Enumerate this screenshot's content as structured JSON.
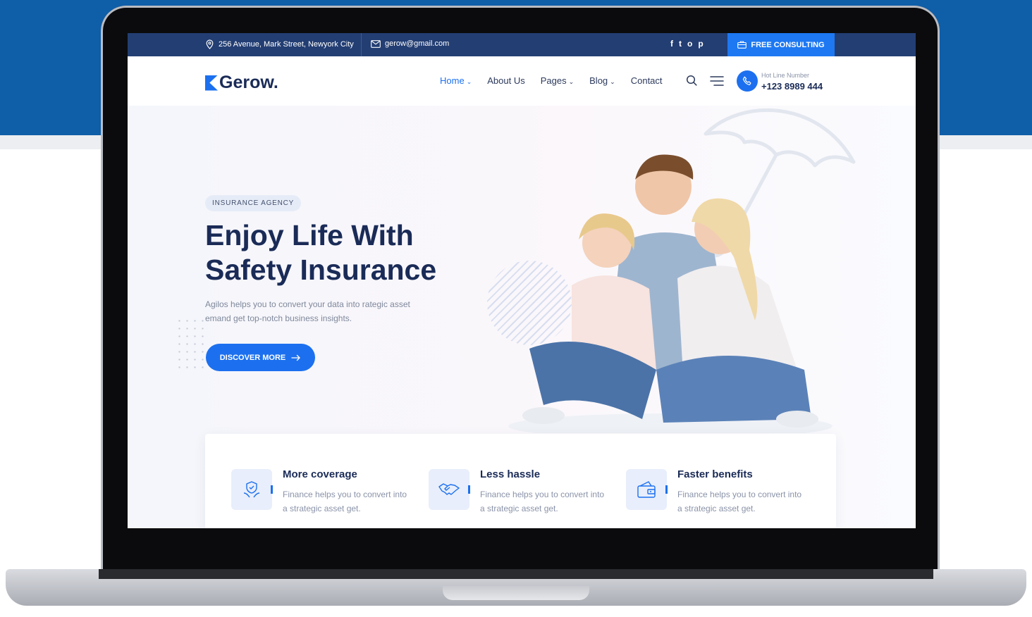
{
  "topbar": {
    "address": "256 Avenue, Mark Street, Newyork City",
    "email": "gerow@gmail.com",
    "social": [
      "f",
      "t",
      "o",
      "p"
    ],
    "consult_label": "FREE CONSULTING"
  },
  "header": {
    "logo": "Gerow.",
    "nav": [
      {
        "label": "Home",
        "dropdown": true,
        "active": true
      },
      {
        "label": "About Us",
        "dropdown": false
      },
      {
        "label": "Pages",
        "dropdown": true
      },
      {
        "label": "Blog",
        "dropdown": true
      },
      {
        "label": "Contact",
        "dropdown": false
      }
    ],
    "hotline_label": "Hot Line Number",
    "hotline_number": "+123 8989 444"
  },
  "hero": {
    "tag": "INSURANCE AGENCY",
    "title_line1": "Enjoy Life With",
    "title_line2": "Safety Insurance",
    "description_line1": "Agilos helps you to convert your data into rategic asset",
    "description_line2": "emand get top-notch business insights.",
    "button_label": "DISCOVER MORE"
  },
  "features": [
    {
      "title": "More coverage",
      "text_line1": "Finance helps you to convert into",
      "text_line2": "a strategic asset get.",
      "icon": "shield-hands-icon"
    },
    {
      "title": "Less hassle",
      "text_line1": "Finance helps you to convert into",
      "text_line2": "a strategic asset get.",
      "icon": "handshake-icon"
    },
    {
      "title": "Faster benefits",
      "text_line1": "Finance helps you to convert into",
      "text_line2": "a strategic asset get.",
      "icon": "wallet-icon"
    }
  ],
  "colors": {
    "brand_blue": "#1c70ef",
    "topbar_navy": "#233e73",
    "heading_navy": "#1a2b57",
    "background_blue": "#0f5ea8"
  }
}
